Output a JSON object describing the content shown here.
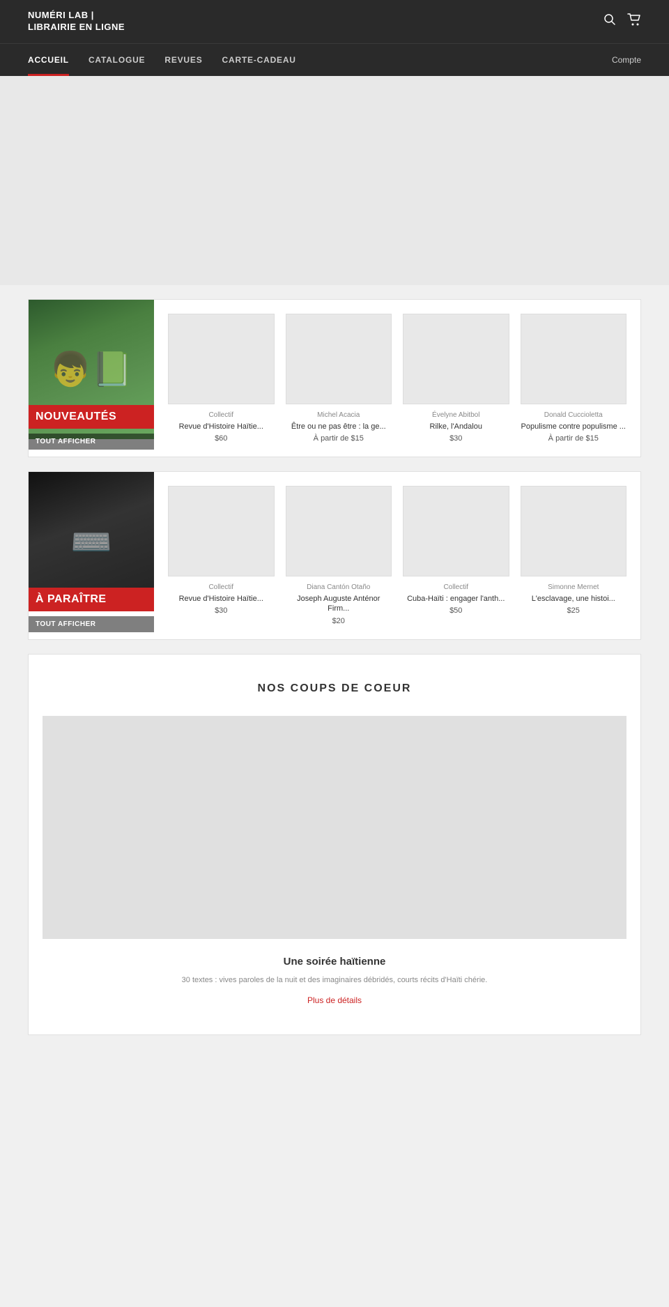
{
  "header": {
    "logo": "NUMÉRI LAB | LIBRAIRIE EN LIGNE",
    "search_icon": "🔍",
    "cart_icon": "🛒"
  },
  "nav": {
    "items": [
      {
        "label": "ACCUEIL",
        "active": true
      },
      {
        "label": "CATALOGUE",
        "active": false
      },
      {
        "label": "REVUES",
        "active": false
      },
      {
        "label": "CARTE-CADEAU",
        "active": false
      }
    ],
    "account_label": "Compte"
  },
  "nouveautes": {
    "banner_label": "NOUVEAUTÉS",
    "show_all": "TOUT AFFICHER",
    "books": [
      {
        "author": "Collectif",
        "title": "Revue d'Histoire Haïtie...",
        "price": "$60"
      },
      {
        "author": "Michel Acacia",
        "title": "Être ou ne pas être : la ge...",
        "price": "À partir de $15"
      },
      {
        "author": "Évelyne Abitbol",
        "title": "Rilke, l'Andalou",
        "price": "$30"
      },
      {
        "author": "Donald Cuccioletta",
        "title": "Populisme contre populisme ...",
        "price": "À partir de $15"
      }
    ]
  },
  "paraite": {
    "banner_label": "À PARAÎTRE",
    "show_all": "TOUT AFFICHER",
    "books": [
      {
        "author": "Collectif",
        "title": "Revue d'Histoire Haïtie...",
        "price": "$30"
      },
      {
        "author": "Diana Cantón Otaño",
        "title": "Joseph Auguste Anténor Firm...",
        "price": "$20"
      },
      {
        "author": "Collectif",
        "title": "Cuba-Haïti : engager l'anth...",
        "price": "$50"
      },
      {
        "author": "Simonne Mernet",
        "title": "L'esclavage, une histoi...",
        "price": "$25"
      }
    ]
  },
  "coups": {
    "section_title": "NOS COUPS DE COEUR",
    "book_title": "Une soirée haïtienne",
    "description": "30 textes : vives paroles de la nuit et des imaginaires débridés, courts récits d'Haïti chérie.",
    "link_label": "Plus de détails"
  }
}
